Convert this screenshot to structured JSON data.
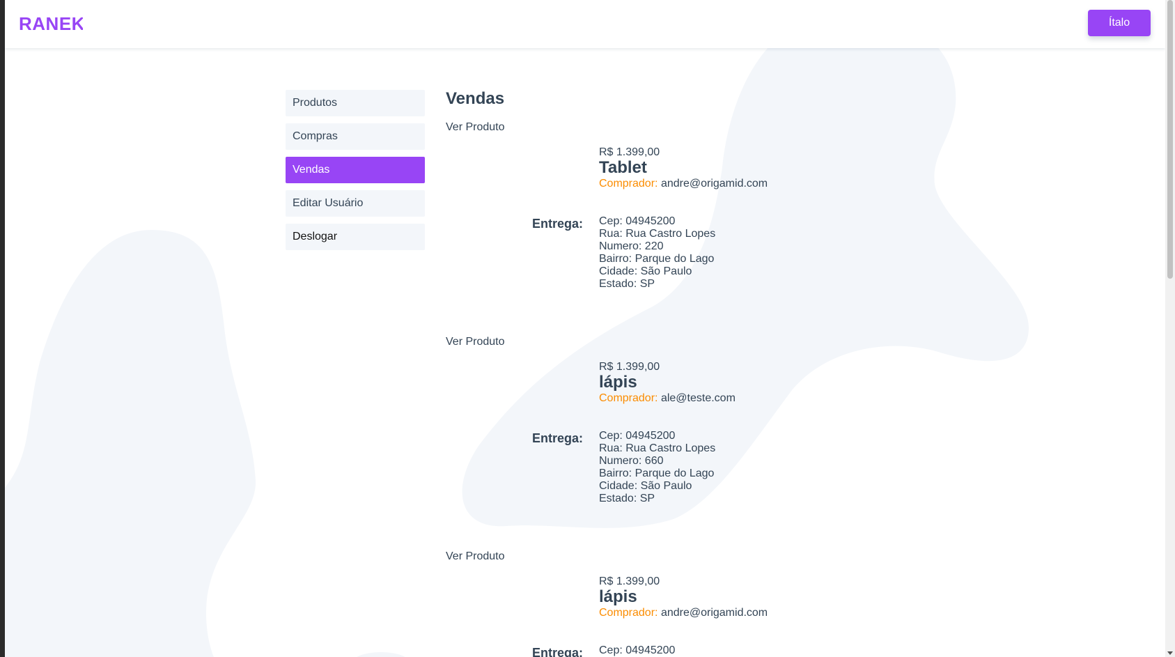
{
  "header": {
    "logo_text": "RANEK",
    "user_button_label": "Ítalo",
    "brand_color": "#9845f5"
  },
  "sidebar": {
    "items": [
      {
        "label": "Produtos",
        "active": false
      },
      {
        "label": "Compras",
        "active": false
      },
      {
        "label": "Vendas",
        "active": true
      },
      {
        "label": "Editar Usuário",
        "active": false
      },
      {
        "label": "Deslogar",
        "active": false
      }
    ]
  },
  "main": {
    "title": "Vendas",
    "sales": [
      {
        "link_label": "Ver Produto",
        "price": "R$ 1.399,00",
        "name": "Tablet",
        "buyer_label": "Comprador:",
        "buyer_email": "andre@origamid.com",
        "delivery_label": "Entrega:",
        "address": {
          "cep": "Cep: 04945200",
          "rua": "Rua: Rua Castro Lopes",
          "numero": "Numero: 220",
          "bairro": "Bairro: Parque do Lago",
          "cidade": "Cidade: São Paulo",
          "estado": "Estado: SP"
        }
      },
      {
        "link_label": "Ver Produto",
        "price": "R$ 1.399,00",
        "name": "lápis",
        "buyer_label": "Comprador:",
        "buyer_email": "ale@teste.com",
        "delivery_label": "Entrega:",
        "address": {
          "cep": "Cep: 04945200",
          "rua": "Rua: Rua Castro Lopes",
          "numero": "Numero: 660",
          "bairro": "Bairro: Parque do Lago",
          "cidade": "Cidade: São Paulo",
          "estado": "Estado: SP"
        }
      },
      {
        "link_label": "Ver Produto",
        "price": "R$ 1.399,00",
        "name": "lápis",
        "buyer_label": "Comprador:",
        "buyer_email": "andre@origamid.com",
        "delivery_label": "Entrega:",
        "address": {
          "cep": "Cep: 04945200"
        }
      }
    ]
  }
}
